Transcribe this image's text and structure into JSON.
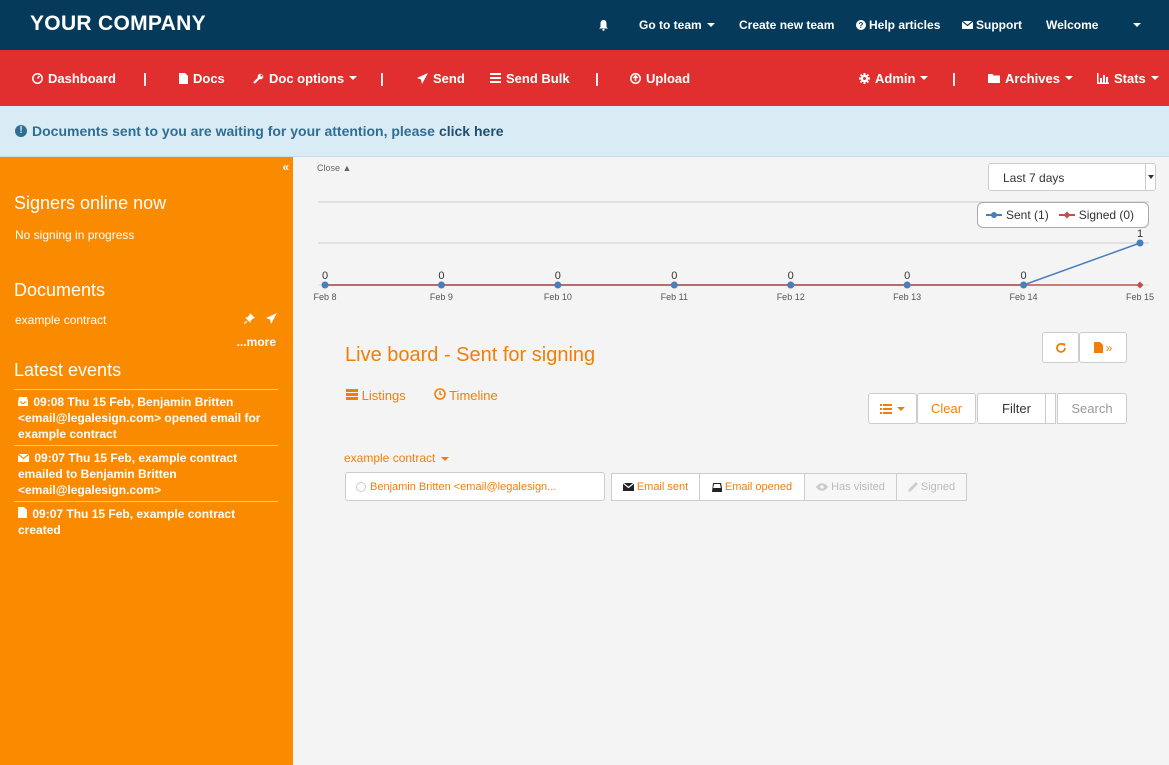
{
  "topbar": {
    "brand": "YOUR COMPANY",
    "bell_icon": "bell-icon",
    "go_to_team": "Go to team",
    "create_team": "Create new team",
    "help": "Help articles",
    "support": "Support",
    "welcome": "Welcome"
  },
  "nav": {
    "dashboard": "Dashboard",
    "docs": "Docs",
    "doc_options": "Doc options",
    "send": "Send",
    "send_bulk": "Send Bulk",
    "upload": "Upload",
    "admin": "Admin",
    "archives": "Archives",
    "stats": "Stats",
    "separator": "|"
  },
  "alert": {
    "message": "Documents sent to you are waiting for your attention, please",
    "link": "click here"
  },
  "sidebar": {
    "collapse": "«",
    "signers_title": "Signers online now",
    "signers_status": "No signing in progress",
    "documents_title": "Documents",
    "document_item": "example contract",
    "more": "...more",
    "events_title": "Latest events",
    "events": [
      "09:08 Thu 15 Feb, Benjamin Britten <email@legalesign.com> opened email for example contract",
      "09:07 Thu 15 Feb, example contract emailed to Benjamin Britten <email@legalesign.com>",
      "09:07 Thu 15 Feb, example contract created"
    ]
  },
  "main": {
    "close": "Close",
    "range": "Last 7 days",
    "legend_sent": "Sent (1)",
    "legend_signed": "Signed (0)",
    "live_board_title": "Live board - Sent for signing",
    "listings": "Listings",
    "timeline": "Timeline",
    "clear": "Clear",
    "filter": "Filter",
    "search_placeholder": "Search",
    "doc_title": "example contract",
    "signer": "Benjamin Britten <email@legalesign...",
    "steps": [
      "Email sent",
      "Email opened",
      "Has visited",
      "Signed"
    ]
  },
  "colors": {
    "topbar": "#063a5a",
    "rednav": "#e12f2f",
    "sidebar": "#fa8a00",
    "accent": "#f07f09",
    "sent_series": "#4a7ebb",
    "signed_series": "#c0504d"
  },
  "chart_data": {
    "type": "line",
    "x": [
      "Feb 8",
      "Feb 9",
      "Feb 10",
      "Feb 11",
      "Feb 12",
      "Feb 13",
      "Feb 14",
      "Feb 15"
    ],
    "series": [
      {
        "name": "Sent",
        "values": [
          0,
          0,
          0,
          0,
          0,
          0,
          0,
          1
        ]
      },
      {
        "name": "Signed",
        "values": [
          0,
          0,
          0,
          0,
          0,
          0,
          0,
          0
        ]
      }
    ],
    "data_labels": [
      "0",
      "0",
      "0",
      "0",
      "0",
      "0",
      "0",
      "1"
    ],
    "legend_position": "top-right",
    "grid": true
  }
}
